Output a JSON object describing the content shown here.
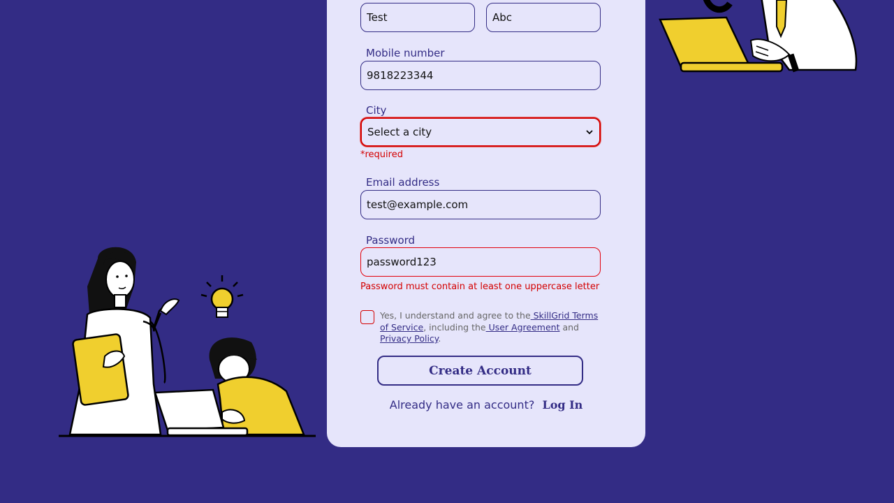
{
  "form": {
    "first_name_value": "Test",
    "last_name_value": "Abc",
    "mobile": {
      "label": "Mobile number",
      "value": "9818223344"
    },
    "city": {
      "label": "City",
      "selected": "Select a city",
      "error": "*required"
    },
    "email": {
      "label": "Email address",
      "value": "test@example.com"
    },
    "password": {
      "label": "Password",
      "value": "password123",
      "error": "Password must contain at least one uppercase letter"
    },
    "terms": {
      "prefix": "Yes, I understand and agree to the",
      "tos_link": " SkillGrid Terms of Service",
      "middle": ", including the",
      "ua_link": " User Agreement",
      "and": " and",
      "privacy_link": "Privacy Policy",
      "end": "."
    },
    "create_button": "Create Account",
    "login_prompt": "Already have an account?",
    "login_link": "Log In"
  },
  "colors": {
    "background": "#332c85",
    "card": "#e6e5fb",
    "accent": "#332c85",
    "error": "#d40000",
    "illustration_yellow": "#f0cf2e"
  },
  "icons": {
    "city_dropdown": "chevron-down-icon"
  }
}
